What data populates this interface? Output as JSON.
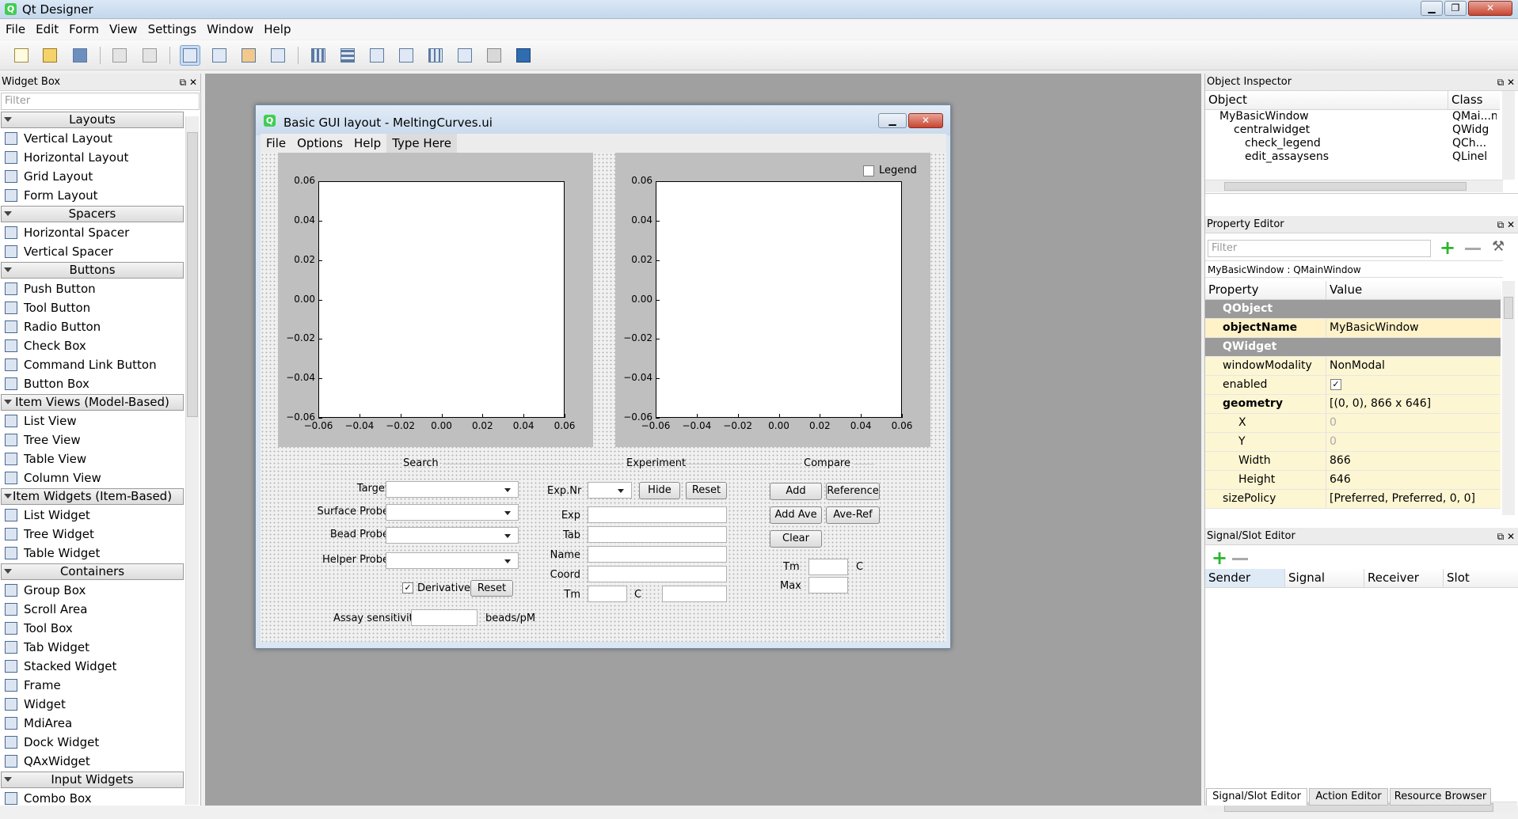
{
  "app": {
    "title": "Qt Designer"
  },
  "window_buttons": {
    "minimize": "▁",
    "maximize": "❐",
    "close": "✕"
  },
  "menu": [
    "File",
    "Edit",
    "Form",
    "View",
    "Settings",
    "Window",
    "Help"
  ],
  "toolbar": {
    "icons": [
      "new-form-icon",
      "open-form-icon",
      "save-form-icon",
      "cut-icon",
      "paste-icon",
      "edit-widgets-icon",
      "edit-signals-slots-icon",
      "edit-buddies-icon",
      "edit-tab-order-icon",
      "layout-horizontal-icon",
      "layout-vertical-icon",
      "layout-horizontal-splitter-icon",
      "layout-vertical-splitter-icon",
      "layout-grid-icon",
      "layout-form-icon",
      "break-layout-icon",
      "adjust-size-icon"
    ]
  },
  "widget_box": {
    "title": "Widget Box",
    "filter_placeholder": "Filter",
    "sections": [
      {
        "name": "Layouts",
        "items": [
          "Vertical Layout",
          "Horizontal Layout",
          "Grid Layout",
          "Form Layout"
        ]
      },
      {
        "name": "Spacers",
        "items": [
          "Horizontal Spacer",
          "Vertical Spacer"
        ]
      },
      {
        "name": "Buttons",
        "items": [
          "Push Button",
          "Tool Button",
          "Radio Button",
          "Check Box",
          "Command Link Button",
          "Button Box"
        ]
      },
      {
        "name": "Item Views (Model-Based)",
        "items": [
          "List View",
          "Tree View",
          "Table View",
          "Column View"
        ]
      },
      {
        "name": "Item Widgets (Item-Based)",
        "items": [
          "List Widget",
          "Tree Widget",
          "Table Widget"
        ]
      },
      {
        "name": "Containers",
        "items": [
          "Group Box",
          "Scroll Area",
          "Tool Box",
          "Tab Widget",
          "Stacked Widget",
          "Frame",
          "Widget",
          "MdiArea",
          "Dock Widget",
          "QAxWidget"
        ]
      },
      {
        "name": "Input Widgets",
        "items": [
          "Combo Box"
        ]
      }
    ]
  },
  "form": {
    "title": "Basic GUI layout - MeltingCurves.ui",
    "menu": [
      "File",
      "Options",
      "Help",
      "Type Here"
    ],
    "legend_label": "Legend",
    "search": {
      "title": "Search",
      "target": "Target",
      "surface_probe": "Surface Probe",
      "bead_probe": "Bead Probe",
      "helper_probe": "Helper Probe",
      "derivative": "Derivative",
      "reset": "Reset"
    },
    "experiment": {
      "title": "Experiment",
      "exp_nr": "Exp.Nr",
      "hide": "Hide",
      "reset": "Reset",
      "exp": "Exp",
      "tab": "Tab",
      "name": "Name",
      "coord": "Coord",
      "tm": "Tm",
      "c": "C"
    },
    "compare": {
      "title": "Compare",
      "add": "Add",
      "reference": "Reference",
      "add_ave": "Add Ave",
      "ave_ref": "Ave-Ref",
      "clear": "Clear",
      "tm": "Tm",
      "c": "C",
      "max": "Max"
    },
    "assay_sensitivity": "Assay sensitivity",
    "units": "beads/pM"
  },
  "chart_data": [
    {
      "type": "line",
      "series": [],
      "xlim": [
        -0.06,
        0.06
      ],
      "ylim": [
        -0.06,
        0.06
      ],
      "xticks": [
        "−0.06",
        "−0.04",
        "−0.02",
        "0.00",
        "0.02",
        "0.04",
        "0.06"
      ],
      "yticks": [
        "0.06",
        "0.04",
        "0.02",
        "0.00",
        "−0.02",
        "−0.04",
        "−0.06"
      ],
      "legend": false
    },
    {
      "type": "line",
      "series": [],
      "xlim": [
        -0.06,
        0.06
      ],
      "ylim": [
        -0.06,
        0.06
      ],
      "xticks": [
        "−0.06",
        "−0.04",
        "−0.02",
        "0.00",
        "0.02",
        "0.04",
        "0.06"
      ],
      "yticks": [
        "0.06",
        "0.04",
        "0.02",
        "0.00",
        "−0.02",
        "−0.04",
        "−0.06"
      ],
      "legend": false
    }
  ],
  "object_inspector": {
    "title": "Object Inspector",
    "col_object": "Object",
    "col_class": "Class",
    "rows": [
      {
        "object": "MyBasicWindow",
        "class": "QMai...ndc"
      },
      {
        "object": "centralwidget",
        "class": "QWidg"
      },
      {
        "object": "check_legend",
        "class": "QCh..."
      },
      {
        "object": "edit_assaysens",
        "class": "QLinel"
      }
    ]
  },
  "property_editor": {
    "title": "Property Editor",
    "filter_placeholder": "Filter",
    "context": "MyBasicWindow : QMainWindow",
    "col_property": "Property",
    "col_value": "Value",
    "rows": [
      {
        "name": "QObject",
        "value": ""
      },
      {
        "name": "objectName",
        "value": "MyBasicWindow"
      },
      {
        "name": "QWidget",
        "value": ""
      },
      {
        "name": "windowModality",
        "value": "NonModal"
      },
      {
        "name": "enabled",
        "value": ""
      },
      {
        "name": "geometry",
        "value": "[(0, 0), 866 x 646]"
      },
      {
        "name": "X",
        "value": "0"
      },
      {
        "name": "Y",
        "value": "0"
      },
      {
        "name": "Width",
        "value": "866"
      },
      {
        "name": "Height",
        "value": "646"
      },
      {
        "name": "sizePolicy",
        "value": "[Preferred, Preferred, 0, 0]"
      }
    ]
  },
  "signal_slot": {
    "title": "Signal/Slot Editor",
    "cols": [
      "Sender",
      "Signal",
      "Receiver",
      "Slot"
    ]
  },
  "bottom_tabs": [
    "Signal/Slot Editor",
    "Action Editor",
    "Resource Browser"
  ]
}
